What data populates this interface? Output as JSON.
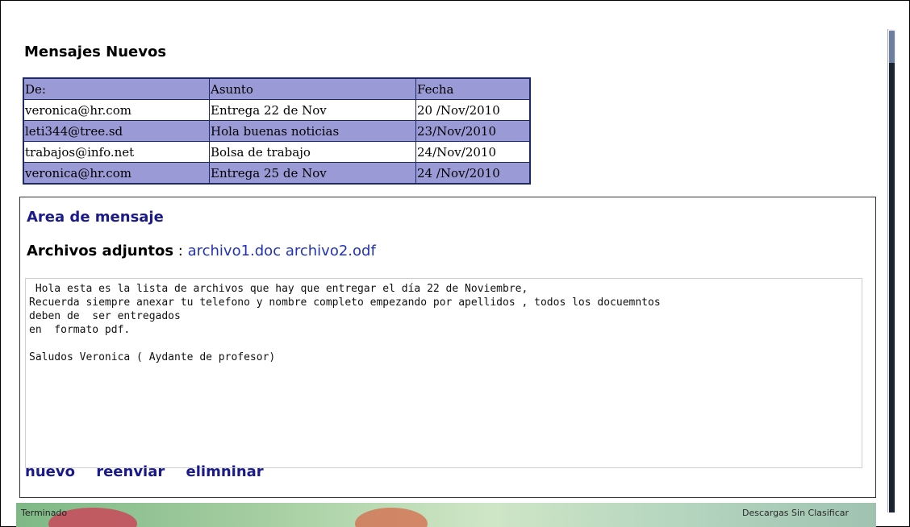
{
  "page": {
    "heading": "Mensajes Nuevos"
  },
  "inbox": {
    "headers": [
      "De:",
      "Asunto",
      "Fecha"
    ],
    "rows": [
      {
        "from": "veronica@hr.com",
        "subject": "Entrega 22 de Nov",
        "date": "20 /Nov/2010"
      },
      {
        "from": "leti344@tree.sd",
        "subject": "Hola buenas noticias",
        "date": "23/Nov/2010"
      },
      {
        "from": "trabajos@info.net",
        "subject": "Bolsa de trabajo",
        "date": "24/Nov/2010"
      },
      {
        "from": "veronica@hr.com",
        "subject": "Entrega 25 de Nov",
        "date": "24 /Nov/2010"
      }
    ]
  },
  "message": {
    "area_title": "Area de mensaje",
    "attachments_label": "Archivos adjuntos",
    "attachments_sep": " : ",
    "attachment_1": "archivo1.doc",
    "attachment_2": "archivo2.odf",
    "body": " Hola esta es la lista de archivos que hay que entregar el día 22 de Noviembre,\nRecuerda siempre anexar tu telefono y nombre completo empezando por apellidos , todos los docuemntos\ndeben de  ser entregados\nen  formato pdf.\n\nSaludos Veronica ( Aydante de profesor)"
  },
  "actions": {
    "new": "nuevo",
    "forward": "reenviar",
    "delete": "elimninar"
  },
  "status_bar": {
    "left": "Terminado",
    "right": "Descargas    Sin Clasificar"
  },
  "colors": {
    "row_purple": "#9a9ad6",
    "link_blue": "#1a1a8c",
    "table_border": "#1d2a66"
  }
}
